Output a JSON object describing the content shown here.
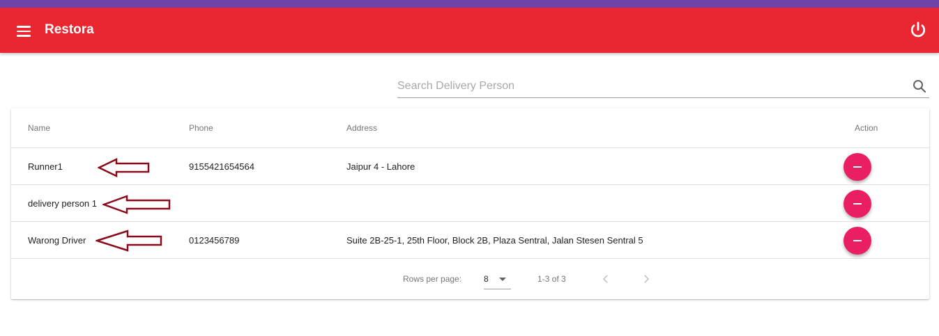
{
  "app": {
    "title": "Restora"
  },
  "icons": {
    "menu": "menu-icon",
    "power": "power-icon",
    "search": "search-icon",
    "remove": "minus-icon",
    "prev": "chevron-left-icon",
    "next": "chevron-right-icon"
  },
  "colors": {
    "appbar": "#ea2630",
    "top_strip": "#6e44a6",
    "remove_button": "#e91e63",
    "arrow_annotation": "#8b0a1a"
  },
  "search": {
    "placeholder": "Search Delivery Person",
    "value": ""
  },
  "table": {
    "columns": {
      "name": "Name",
      "phone": "Phone",
      "address": "Address",
      "action": "Action"
    },
    "rows": [
      {
        "name": "Runner1",
        "phone": "9155421654564",
        "address": "Jaipur 4 - Lahore"
      },
      {
        "name": "delivery person 1",
        "phone": "",
        "address": ""
      },
      {
        "name": "Warong Driver",
        "phone": "0123456789",
        "address": "Suite 2B-25-1, 25th Floor, Block 2B, Plaza Sentral, Jalan Stesen Sentral 5"
      }
    ]
  },
  "pagination": {
    "rows_per_page_label": "Rows per page:",
    "rows_per_page": "8",
    "range": "1-3 of 3"
  }
}
